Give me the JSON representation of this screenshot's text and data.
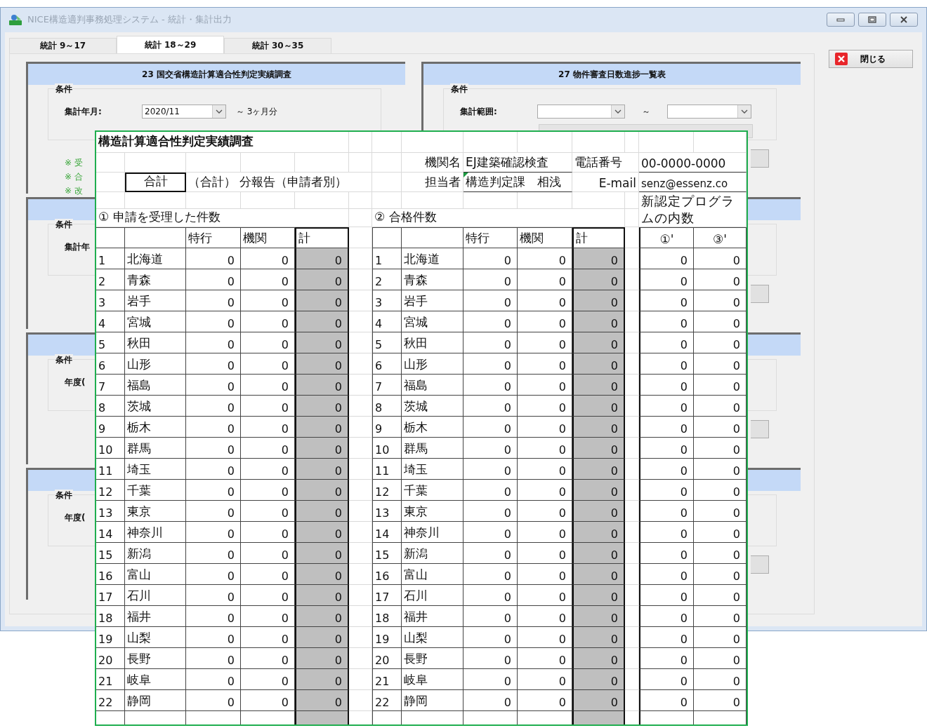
{
  "window": {
    "title": "NICE構造適判事務処理システム - 統計・集計出力"
  },
  "tabs": [
    {
      "label": "統計 9～17",
      "selected": false
    },
    {
      "label": "統計 18～29",
      "selected": true
    },
    {
      "label": "統計 30～35",
      "selected": false
    }
  ],
  "close_button": {
    "label": "閉じる"
  },
  "left_panels": [
    {
      "kind": "month",
      "header": "23 国交省構造計算適合性判定実績調査",
      "group": "条件",
      "field_label": "集計年月:",
      "dropdown_value": "2020/11",
      "range_note": "～ 3ヶ月分",
      "notes": [
        "※ 受",
        "※ 合",
        "※ 改"
      ]
    },
    {
      "kind": "label_only",
      "group": "条件",
      "field_label": "集計年"
    },
    {
      "kind": "label_only",
      "group": "条件",
      "field_label": "年度("
    },
    {
      "kind": "label_only",
      "group": "条件",
      "field_label": "年度("
    }
  ],
  "right_panels": [
    {
      "kind": "range",
      "header": "27 物件審査日数進捗一覧表",
      "group": "条件",
      "field_label": "集計範囲:",
      "range_separator": "～"
    },
    {
      "kind": "blank"
    },
    {
      "kind": "blank"
    },
    {
      "kind": "blank"
    }
  ],
  "sheet": {
    "title": "構造計算適合性判定実績調査",
    "org_label": "機関名",
    "org_value": "EJ建築確認検査",
    "phone_label": "電話番号",
    "phone_value": "00-0000-0000",
    "report_box": "合計",
    "report_text": "（合計） 分報告（申請者別）",
    "person_label": "担当者",
    "person_value": "構造判定課　相浅",
    "email_label": "E-mail",
    "email_value": "senz@essenz.co",
    "section_1": "① 申請を受理した件数",
    "section_2": "② 合格件数",
    "section_3": "新認定プログラムの内数",
    "columns_1": [
      "特行",
      "機関",
      "計"
    ],
    "columns_2": [
      "特行",
      "機関",
      "計"
    ],
    "columns_3": [
      "①'",
      "③'"
    ],
    "rows": [
      {
        "no_1": "1",
        "pref_1": "北海道",
        "received": [
          "0",
          "0",
          "0"
        ],
        "no_2": "1",
        "pref_2": "北海道",
        "passed": [
          "0",
          "0",
          "0"
        ],
        "new_program": [
          "0",
          "0"
        ]
      },
      {
        "no_1": "2",
        "pref_1": "青森",
        "received": [
          "0",
          "0",
          "0"
        ],
        "no_2": "2",
        "pref_2": "青森",
        "passed": [
          "0",
          "0",
          "0"
        ],
        "new_program": [
          "0",
          "0"
        ]
      },
      {
        "no_1": "3",
        "pref_1": "岩手",
        "received": [
          "0",
          "0",
          "0"
        ],
        "no_2": "3",
        "pref_2": "岩手",
        "passed": [
          "0",
          "0",
          "0"
        ],
        "new_program": [
          "0",
          "0"
        ]
      },
      {
        "no_1": "4",
        "pref_1": "宮城",
        "received": [
          "0",
          "0",
          "0"
        ],
        "no_2": "4",
        "pref_2": "宮城",
        "passed": [
          "0",
          "0",
          "0"
        ],
        "new_program": [
          "0",
          "0"
        ]
      },
      {
        "no_1": "5",
        "pref_1": "秋田",
        "received": [
          "0",
          "0",
          "0"
        ],
        "no_2": "5",
        "pref_2": "秋田",
        "passed": [
          "0",
          "0",
          "0"
        ],
        "new_program": [
          "0",
          "0"
        ]
      },
      {
        "no_1": "6",
        "pref_1": "山形",
        "received": [
          "0",
          "0",
          "0"
        ],
        "no_2": "6",
        "pref_2": "山形",
        "passed": [
          "0",
          "0",
          "0"
        ],
        "new_program": [
          "0",
          "0"
        ]
      },
      {
        "no_1": "7",
        "pref_1": "福島",
        "received": [
          "0",
          "0",
          "0"
        ],
        "no_2": "7",
        "pref_2": "福島",
        "passed": [
          "0",
          "0",
          "0"
        ],
        "new_program": [
          "0",
          "0"
        ]
      },
      {
        "no_1": "8",
        "pref_1": "茨城",
        "received": [
          "0",
          "0",
          "0"
        ],
        "no_2": "8",
        "pref_2": "茨城",
        "passed": [
          "0",
          "0",
          "0"
        ],
        "new_program": [
          "0",
          "0"
        ]
      },
      {
        "no_1": "9",
        "pref_1": "栃木",
        "received": [
          "0",
          "0",
          "0"
        ],
        "no_2": "9",
        "pref_2": "栃木",
        "passed": [
          "0",
          "0",
          "0"
        ],
        "new_program": [
          "0",
          "0"
        ]
      },
      {
        "no_1": "10",
        "pref_1": "群馬",
        "received": [
          "0",
          "0",
          "0"
        ],
        "no_2": "10",
        "pref_2": "群馬",
        "passed": [
          "0",
          "0",
          "0"
        ],
        "new_program": [
          "0",
          "0"
        ]
      },
      {
        "no_1": "11",
        "pref_1": "埼玉",
        "received": [
          "0",
          "0",
          "0"
        ],
        "no_2": "11",
        "pref_2": "埼玉",
        "passed": [
          "0",
          "0",
          "0"
        ],
        "new_program": [
          "0",
          "0"
        ]
      },
      {
        "no_1": "12",
        "pref_1": "千葉",
        "received": [
          "0",
          "0",
          "0"
        ],
        "no_2": "12",
        "pref_2": "千葉",
        "passed": [
          "0",
          "0",
          "0"
        ],
        "new_program": [
          "0",
          "0"
        ]
      },
      {
        "no_1": "13",
        "pref_1": "東京",
        "received": [
          "0",
          "0",
          "0"
        ],
        "no_2": "13",
        "pref_2": "東京",
        "passed": [
          "0",
          "0",
          "0"
        ],
        "new_program": [
          "0",
          "0"
        ]
      },
      {
        "no_1": "14",
        "pref_1": "神奈川",
        "received": [
          "0",
          "0",
          "0"
        ],
        "no_2": "14",
        "pref_2": "神奈川",
        "passed": [
          "0",
          "0",
          "0"
        ],
        "new_program": [
          "0",
          "0"
        ]
      },
      {
        "no_1": "15",
        "pref_1": "新潟",
        "received": [
          "0",
          "0",
          "0"
        ],
        "no_2": "15",
        "pref_2": "新潟",
        "passed": [
          "0",
          "0",
          "0"
        ],
        "new_program": [
          "0",
          "0"
        ]
      },
      {
        "no_1": "16",
        "pref_1": "富山",
        "received": [
          "0",
          "0",
          "0"
        ],
        "no_2": "16",
        "pref_2": "富山",
        "passed": [
          "0",
          "0",
          "0"
        ],
        "new_program": [
          "0",
          "0"
        ]
      },
      {
        "no_1": "17",
        "pref_1": "石川",
        "received": [
          "0",
          "0",
          "0"
        ],
        "no_2": "17",
        "pref_2": "石川",
        "passed": [
          "0",
          "0",
          "0"
        ],
        "new_program": [
          "0",
          "0"
        ]
      },
      {
        "no_1": "18",
        "pref_1": "福井",
        "received": [
          "0",
          "0",
          "0"
        ],
        "no_2": "18",
        "pref_2": "福井",
        "passed": [
          "0",
          "0",
          "0"
        ],
        "new_program": [
          "0",
          "0"
        ]
      },
      {
        "no_1": "19",
        "pref_1": "山梨",
        "received": [
          "0",
          "0",
          "0"
        ],
        "no_2": "19",
        "pref_2": "山梨",
        "passed": [
          "0",
          "0",
          "0"
        ],
        "new_program": [
          "0",
          "0"
        ]
      },
      {
        "no_1": "20",
        "pref_1": "長野",
        "received": [
          "0",
          "0",
          "0"
        ],
        "no_2": "20",
        "pref_2": "長野",
        "passed": [
          "0",
          "0",
          "0"
        ],
        "new_program": [
          "0",
          "0"
        ]
      },
      {
        "no_1": "21",
        "pref_1": "岐阜",
        "received": [
          "0",
          "0",
          "0"
        ],
        "no_2": "21",
        "pref_2": "岐阜",
        "passed": [
          "0",
          "0",
          "0"
        ],
        "new_program": [
          "0",
          "0"
        ]
      },
      {
        "no_1": "22",
        "pref_1": "静岡",
        "received": [
          "0",
          "0",
          "0"
        ],
        "no_2": "22",
        "pref_2": "静岡",
        "passed": [
          "0",
          "0",
          "0"
        ],
        "new_program": [
          "0",
          "0"
        ]
      }
    ]
  }
}
